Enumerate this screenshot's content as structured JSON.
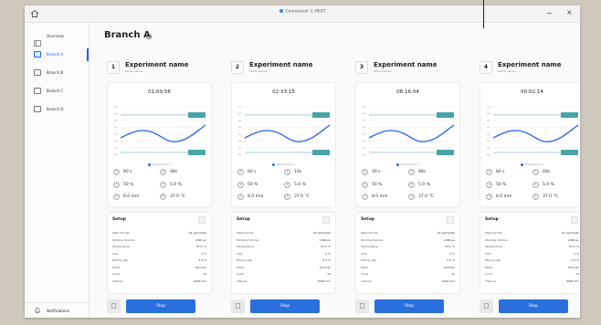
{
  "window": {
    "connection_status": "Connected: C-HEXT",
    "minimize_glyph": "−",
    "close_glyph": "×",
    "home_icon": "home-icon"
  },
  "sidebar": {
    "items": [
      {
        "label": "Overview",
        "icon": "book-icon",
        "active": false
      },
      {
        "label": "Branch A",
        "icon": "display-icon",
        "active": true
      },
      {
        "label": "Branch B",
        "icon": "display-icon",
        "active": false
      },
      {
        "label": "Branch C",
        "icon": "display-icon",
        "active": false
      },
      {
        "label": "Branch D",
        "icon": "display-icon",
        "active": false
      }
    ],
    "notifications_label": "Notifications"
  },
  "page": {
    "title": "Branch A",
    "settings_icon": "gear-icon"
  },
  "experiments": [
    {
      "number": "1",
      "name": "Experiment name",
      "subtitle": "Setup values",
      "timer": "01:00:56",
      "metrics": {
        "time": "90 s",
        "volume": "48s",
        "pct_a": "50 %",
        "pct_b": "5.0 %",
        "dist": "8.0 mm",
        "temp": "37.0 °C"
      },
      "setup": [
        {
          "k": "Plate format",
          "v": "24 well plate"
        },
        {
          "k": "Working Volume",
          "v": "1000 µL"
        },
        {
          "k": "Temperature",
          "v": "37.0 °C"
        },
        {
          "k": "CO2",
          "v": "5 %"
        },
        {
          "k": "Mixing rate",
          "v": "5.0 %"
        },
        {
          "k": "Mode",
          "v": "Periodic"
        },
        {
          "k": "Cycle",
          "v": "10"
        },
        {
          "k": "Interval",
          "v": "2000 min"
        }
      ],
      "stop_label": "Stop"
    },
    {
      "number": "2",
      "name": "Experiment name",
      "subtitle": "Setup values",
      "timer": "02:33:15",
      "metrics": {
        "time": "60 s",
        "volume": "10s",
        "pct_a": "50 %",
        "pct_b": "5.0 %",
        "dist": "8.0 mm",
        "temp": "37.0 °C"
      },
      "setup": [
        {
          "k": "Plate format",
          "v": "24 well plate"
        },
        {
          "k": "Working Volume",
          "v": "1000 µL"
        },
        {
          "k": "Temperature",
          "v": "37.0 °C"
        },
        {
          "k": "CO2",
          "v": "5 %"
        },
        {
          "k": "Mixing rate",
          "v": "5.0 %"
        },
        {
          "k": "Mode",
          "v": "Periodic"
        },
        {
          "k": "Cycle",
          "v": "10"
        },
        {
          "k": "Interval",
          "v": "2000 min"
        }
      ],
      "stop_label": "Stop"
    },
    {
      "number": "3",
      "name": "Experiment name",
      "subtitle": "Setup values",
      "timer": "08:16:04",
      "metrics": {
        "time": "30 s",
        "volume": "88s",
        "pct_a": "50 %",
        "pct_b": "5.0 %",
        "dist": "8.0 mm",
        "temp": "37.0 °C"
      },
      "setup": [
        {
          "k": "Plate format",
          "v": "24 well plate"
        },
        {
          "k": "Working Volume",
          "v": "1000 µL"
        },
        {
          "k": "Temperature",
          "v": "37.0 °C"
        },
        {
          "k": "CO2",
          "v": "5 %"
        },
        {
          "k": "Mixing rate",
          "v": "5.0 %"
        },
        {
          "k": "Mode",
          "v": "Periodic"
        },
        {
          "k": "Cycle",
          "v": "10"
        },
        {
          "k": "Interval",
          "v": "2000 min"
        }
      ],
      "stop_label": "Stop"
    },
    {
      "number": "4",
      "name": "Experiment name",
      "subtitle": "Setup values",
      "timer": "00:02:14",
      "metrics": {
        "time": "80 s",
        "volume": "48s",
        "pct_a": "50 %",
        "pct_b": "5.0 %",
        "dist": "8.0 mm",
        "temp": "37.0 °C"
      },
      "setup": [
        {
          "k": "Plate format",
          "v": "24 well plate"
        },
        {
          "k": "Working Volume",
          "v": "1000 µL"
        },
        {
          "k": "Temperature",
          "v": "37.0 °C"
        },
        {
          "k": "CO2",
          "v": "5 %"
        },
        {
          "k": "Mixing rate",
          "v": "5.0 %"
        },
        {
          "k": "Mode",
          "v": "Periodic"
        },
        {
          "k": "Cycle",
          "v": "10"
        },
        {
          "k": "Interval",
          "v": "2000 min"
        }
      ],
      "stop_label": "Stop"
    }
  ],
  "setup_title": "Setup",
  "legend_label": "Experiment 1",
  "colors": {
    "accent": "#2563eb",
    "button": "#2b6fde",
    "curve": "#2563eb",
    "threshold": "#4aa3a8"
  }
}
